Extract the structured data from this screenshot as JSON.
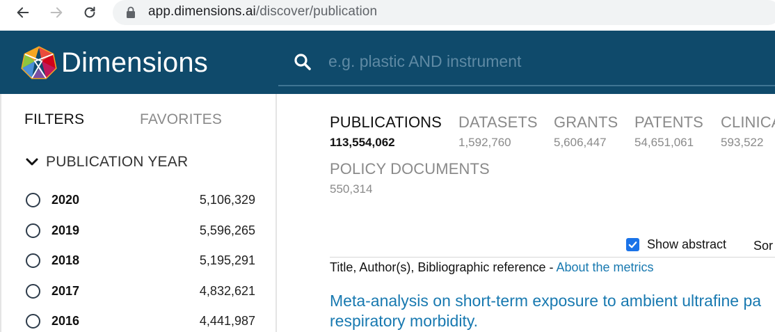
{
  "browser": {
    "url_host": "app.dimensions.ai",
    "url_path": "/discover/publication"
  },
  "header": {
    "brand": "Dimensions",
    "search": {
      "placeholder": "e.g. plastic AND instrument",
      "value": ""
    }
  },
  "sidebar": {
    "tabs": [
      {
        "label": "FILTERS",
        "active": true
      },
      {
        "label": "FAVORITES",
        "active": false
      }
    ],
    "filter_group": {
      "label": "PUBLICATION YEAR",
      "items": [
        {
          "year": "2020",
          "count": "5,106,329"
        },
        {
          "year": "2019",
          "count": "5,596,265"
        },
        {
          "year": "2018",
          "count": "5,195,291"
        },
        {
          "year": "2017",
          "count": "4,832,621"
        },
        {
          "year": "2016",
          "count": "4,441,987"
        }
      ]
    }
  },
  "main": {
    "categories": [
      {
        "label": "PUBLICATIONS",
        "count": "113,554,062",
        "active": true
      },
      {
        "label": "DATASETS",
        "count": "1,592,760",
        "active": false
      },
      {
        "label": "GRANTS",
        "count": "5,606,447",
        "active": false
      },
      {
        "label": "PATENTS",
        "count": "54,651,061",
        "active": false
      },
      {
        "label": "CLINICA",
        "count": "593,522",
        "active": false
      },
      {
        "label": "POLICY DOCUMENTS",
        "count": "550,314",
        "active": false
      }
    ],
    "show_abstract": {
      "label": "Show abstract",
      "checked": true
    },
    "sort_label": "Sor",
    "column_header": {
      "text": "Title, Author(s), Bibliographic reference - ",
      "link": "About the metrics"
    },
    "first_result": {
      "title": "Meta-analysis on short-term exposure to ambient ultrafine pa respiratory morbidity."
    }
  },
  "colors": {
    "header_bg": "#0f4a6b",
    "link": "#1879b0",
    "checkbox": "#1a73e8"
  }
}
